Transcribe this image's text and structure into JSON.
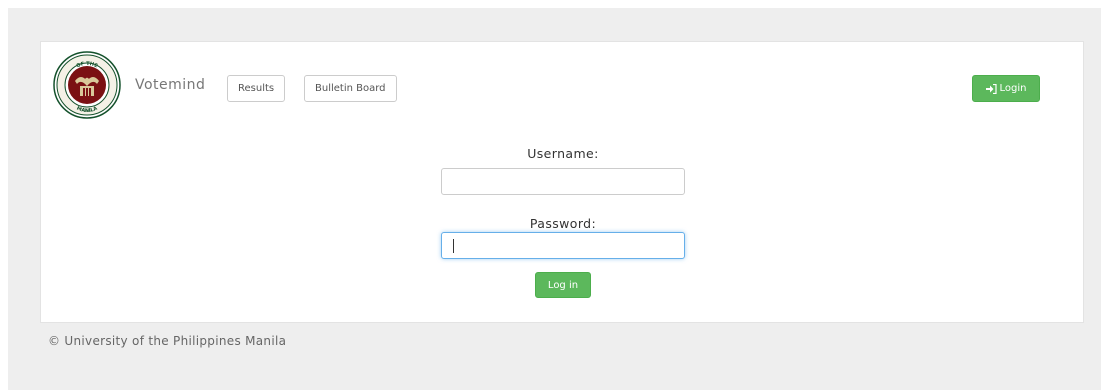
{
  "header": {
    "brand": "Votemind",
    "nav": {
      "results_label": "Results",
      "bulletin_label": "Bulletin Board"
    },
    "login_label": "Login"
  },
  "logo": {
    "ring_top_text": "OF THE",
    "ring_left_text": "UNIVERSITY",
    "ring_right_text": "PHILIPPINES",
    "ring_bottom_text": "MANILA",
    "year": "1908"
  },
  "form": {
    "username_label": "Username:",
    "username_value": "",
    "password_label": "Password:",
    "password_value": "",
    "submit_label": "Log in"
  },
  "footer": {
    "copyright": "© University of the Philippines Manila"
  },
  "colors": {
    "primary_green": "#5cb85c",
    "logo_maroon": "#7b1113",
    "logo_green": "#14512b",
    "focus_blue": "#66afe9"
  },
  "icons": {
    "login": "sign-in-icon"
  }
}
